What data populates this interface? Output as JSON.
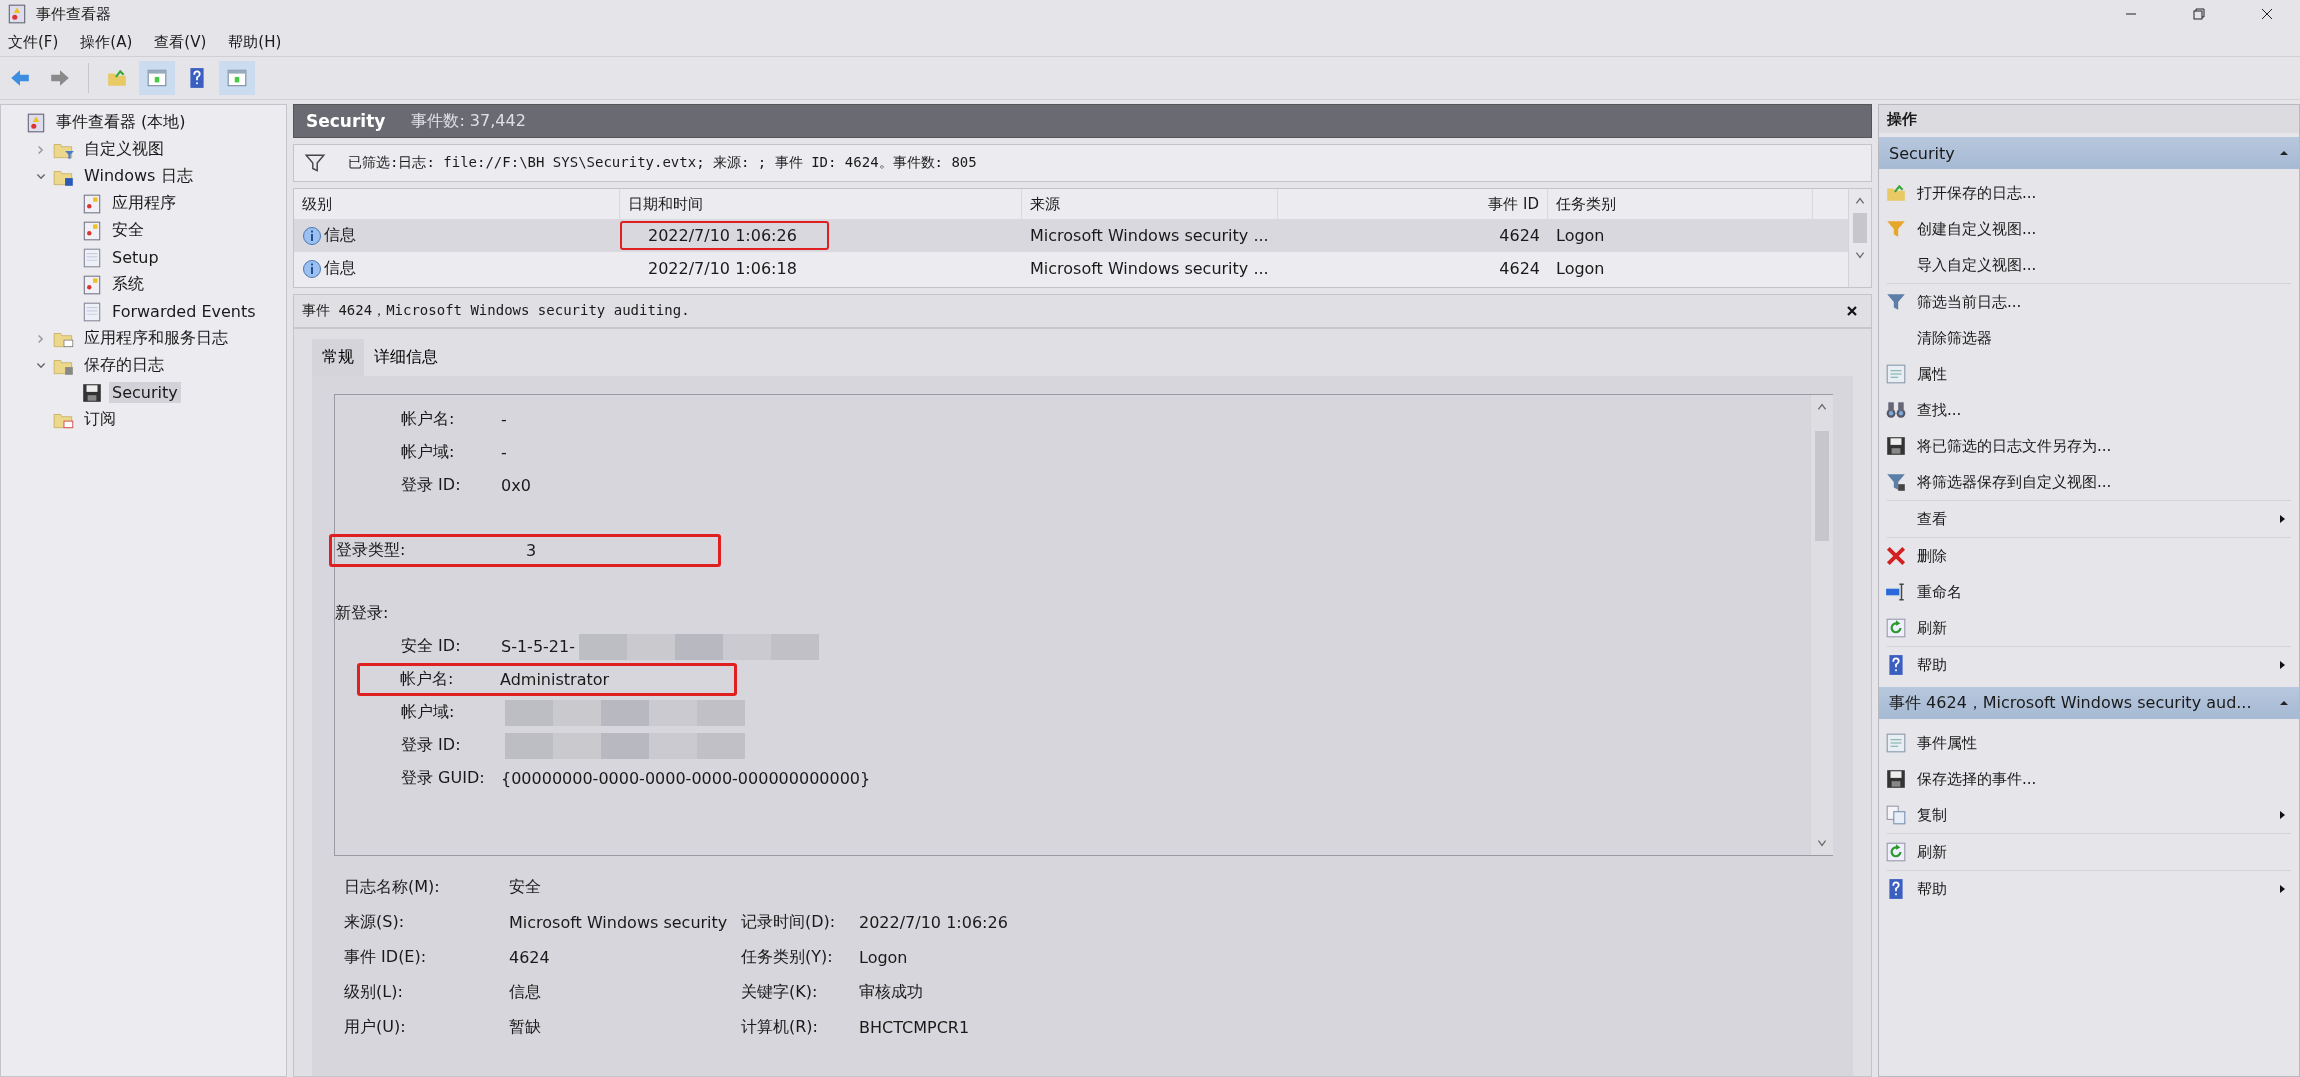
{
  "window": {
    "title": "事件查看器"
  },
  "menu": [
    "文件(F)",
    "操作(A)",
    "查看(V)",
    "帮助(H)"
  ],
  "toolbar": [
    {
      "kind": "back",
      "pressed": false
    },
    {
      "kind": "forward",
      "pressed": false
    },
    {
      "kind": "up",
      "pressed": false
    },
    {
      "kind": "tree-pane",
      "pressed": true
    },
    {
      "kind": "help",
      "pressed": false
    },
    {
      "kind": "action-pane",
      "pressed": true
    }
  ],
  "tree": [
    {
      "label": "事件查看器 (本地)",
      "kind": "root",
      "selected": false,
      "children": [
        {
          "label": "自定义视图",
          "kind": "custom-views",
          "expanded": false,
          "selected": false
        },
        {
          "label": "Windows 日志",
          "kind": "windows-logs",
          "expanded": true,
          "selected": false,
          "children": [
            {
              "label": "应用程序",
              "kind": "log",
              "selected": false
            },
            {
              "label": "安全",
              "kind": "log",
              "selected": false
            },
            {
              "label": "Setup",
              "kind": "plain-log",
              "selected": false
            },
            {
              "label": "系统",
              "kind": "log",
              "selected": false
            },
            {
              "label": "Forwarded Events",
              "kind": "plain-log",
              "selected": false
            }
          ]
        },
        {
          "label": "应用程序和服务日志",
          "kind": "folder",
          "expanded": false,
          "selected": false
        },
        {
          "label": "保存的日志",
          "kind": "saved-logs",
          "expanded": true,
          "selected": false,
          "children": [
            {
              "label": "Security",
              "kind": "saved-log",
              "selected": true
            }
          ]
        },
        {
          "label": "订阅",
          "kind": "subscriptions",
          "selected": false
        }
      ]
    }
  ],
  "log_header": {
    "name": "Security",
    "count": "事件数: 37,442"
  },
  "filter_bar": {
    "text": "已筛选:日志: file://F:\\BH SYS\\Security.evtx; 来源: ; 事件 ID: 4624。事件数: 805"
  },
  "events_table": {
    "columns": [
      "级别",
      "日期和时间",
      "来源",
      "事件 ID",
      "任务类别"
    ],
    "rows": [
      {
        "level": "信息",
        "date": "2022/7/10 1:06:26",
        "source": "Microsoft Windows security ...",
        "event_id": "4624",
        "category": "Logon",
        "selected": true,
        "highlighted": true
      },
      {
        "level": "信息",
        "date": "2022/7/10 1:06:18",
        "source": "Microsoft Windows security ...",
        "event_id": "4624",
        "category": "Logon",
        "selected": false,
        "highlighted": false
      }
    ]
  },
  "event_detail": {
    "title": "事件 4624，Microsoft Windows security auditing.",
    "tabs": [
      {
        "label": "常规",
        "selected": true
      },
      {
        "label": "详细信息",
        "selected": false
      }
    ],
    "description": [
      {
        "kind": "field",
        "label": "帐户名:",
        "value": "-",
        "highlighted": false,
        "redacted": false
      },
      {
        "kind": "field",
        "label": "帐户域:",
        "value": "-",
        "highlighted": false,
        "redacted": false
      },
      {
        "kind": "field",
        "label": "登录 ID:",
        "value": "0x0",
        "highlighted": false,
        "redacted": false
      },
      {
        "kind": "top-field",
        "label": "登录类型:",
        "value": "3",
        "highlighted": true,
        "redacted": false
      },
      {
        "kind": "heading",
        "label": "新登录:"
      },
      {
        "kind": "field",
        "label": "安全 ID:",
        "value": "S-1-5-21-",
        "highlighted": false,
        "redacted": true
      },
      {
        "kind": "field",
        "label": "帐户名:",
        "value": "Administrator",
        "highlighted": true,
        "redacted": false
      },
      {
        "kind": "field",
        "label": "帐户域:",
        "highlighted": false,
        "redacted": true
      },
      {
        "kind": "field",
        "label": "登录 ID:",
        "highlighted": false,
        "redacted": true
      },
      {
        "kind": "field",
        "label": "登录 GUID:",
        "value": "{00000000-0000-0000-0000-000000000000}",
        "highlighted": false,
        "redacted": false
      }
    ],
    "properties": [
      [
        {
          "label": "日志名称(M):",
          "value": "安全"
        }
      ],
      [
        {
          "label": "来源(S):",
          "value": "Microsoft Windows security"
        },
        {
          "label": "记录时间(D):",
          "value": "2022/7/10 1:06:26"
        }
      ],
      [
        {
          "label": "事件 ID(E):",
          "value": "4624"
        },
        {
          "label": "任务类别(Y):",
          "value": "Logon"
        }
      ],
      [
        {
          "label": "级别(L):",
          "value": "信息"
        },
        {
          "label": "关键字(K):",
          "value": "审核成功"
        }
      ],
      [
        {
          "label": "用户(U):",
          "value": "暂缺"
        },
        {
          "label": "计算机(R):",
          "value": "BHCTCMPCR1"
        }
      ]
    ]
  },
  "actions": {
    "title": "操作",
    "sections": [
      {
        "title": "Security",
        "expanded": true,
        "groups": [
          [
            {
              "label": "打开保存的日志...",
              "kind": "open-folder",
              "submenu": false
            },
            {
              "label": "创建自定义视图...",
              "kind": "funnel",
              "submenu": false
            },
            {
              "label": "导入自定义视图...",
              "kind": "none",
              "submenu": false
            }
          ],
          [
            {
              "label": "筛选当前日志...",
              "kind": "funnel-plain",
              "submenu": false
            },
            {
              "label": "清除筛选器",
              "kind": "none",
              "submenu": false
            },
            {
              "label": "属性",
              "kind": "properties",
              "submenu": false
            },
            {
              "label": "查找...",
              "kind": "binoculars",
              "submenu": false
            },
            {
              "label": "将已筛选的日志文件另存为...",
              "kind": "save",
              "submenu": false
            },
            {
              "label": "将筛选器保存到自定义视图...",
              "kind": "funnel-save",
              "submenu": false
            }
          ],
          [
            {
              "label": "查看",
              "kind": "none",
              "submenu": true
            }
          ],
          [
            {
              "label": "删除",
              "kind": "delete",
              "submenu": false
            },
            {
              "label": "重命名",
              "kind": "rename",
              "submenu": false
            },
            {
              "label": "刷新",
              "kind": "refresh",
              "submenu": false
            }
          ],
          [
            {
              "label": "帮助",
              "kind": "help",
              "submenu": true
            }
          ]
        ]
      },
      {
        "title": "事件 4624，Microsoft Windows security aud...",
        "expanded": true,
        "groups": [
          [
            {
              "label": "事件属性",
              "kind": "properties",
              "submenu": false
            },
            {
              "label": "保存选择的事件...",
              "kind": "save",
              "submenu": false
            },
            {
              "label": "复制",
              "kind": "copy",
              "submenu": true
            }
          ],
          [
            {
              "label": "刷新",
              "kind": "refresh",
              "submenu": false
            }
          ],
          [
            {
              "label": "帮助",
              "kind": "help",
              "submenu": true
            }
          ]
        ]
      }
    ]
  }
}
